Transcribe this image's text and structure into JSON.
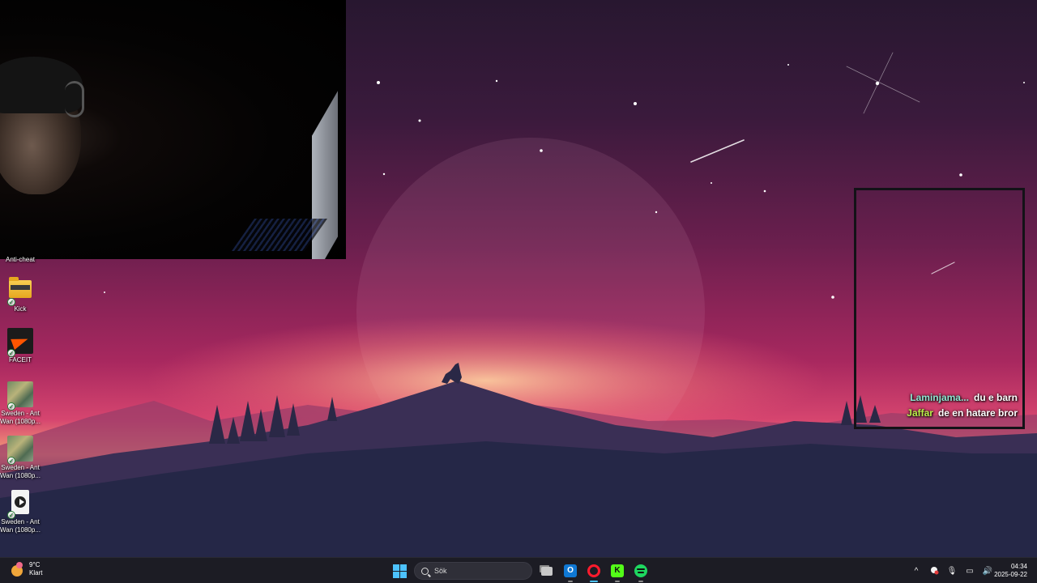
{
  "desktop": {
    "icons": [
      {
        "id": "anticheat",
        "label": "Anti-cheat",
        "type": "shortcut"
      },
      {
        "id": "kick",
        "label": "Kick",
        "type": "folder"
      },
      {
        "id": "faceit",
        "label": "FACEIT",
        "type": "app"
      },
      {
        "id": "sweden1",
        "label": "Sweden - Ant Wan (1080p...",
        "type": "thumbnail"
      },
      {
        "id": "sweden2",
        "label": "Sweden - Ant Wan (1080p...",
        "type": "thumbnail"
      },
      {
        "id": "sweden3",
        "label": "Sweden - Ant Wan (1080p...",
        "type": "video"
      }
    ],
    "check_glyph": "✓"
  },
  "chat": {
    "messages": [
      {
        "user": "Laminjama...",
        "user_color": "#8fe6d2",
        "text": "du e barn"
      },
      {
        "user": "Jaffar",
        "user_color": "#b8ef4a",
        "text": "de en hatare bror"
      }
    ]
  },
  "taskbar": {
    "weather": {
      "temp": "9°C",
      "condition": "Klart"
    },
    "search": {
      "placeholder": "Sök"
    },
    "apps": [
      {
        "name": "task-view",
        "icon": "task-view-icon"
      },
      {
        "name": "outlook",
        "icon": "outlook-icon",
        "glyph": "O"
      },
      {
        "name": "opera-gx",
        "icon": "opera-icon"
      },
      {
        "name": "kick",
        "icon": "kick-icon",
        "glyph": "K"
      },
      {
        "name": "spotify",
        "icon": "spotify-icon"
      }
    ],
    "tray": {
      "chevron": "^",
      "mic": "🎙",
      "network": "▭",
      "volume": "🔊"
    },
    "clock": {
      "time": "04:34",
      "date": "2025-09-22"
    }
  },
  "colors": {
    "accent": "#4cc2ff",
    "chat_border": "#131217",
    "taskbar_bg": "#1c1c24"
  }
}
